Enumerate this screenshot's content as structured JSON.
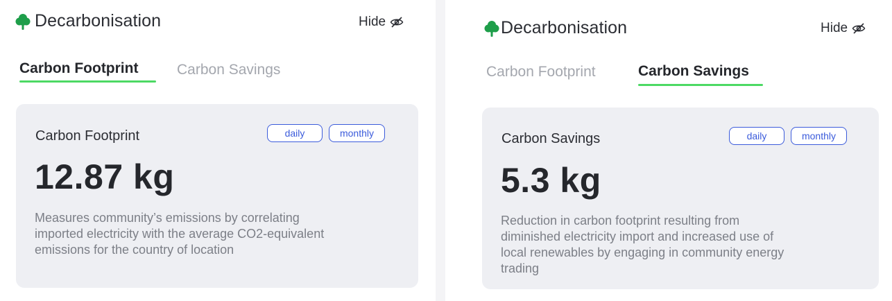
{
  "colors": {
    "accent_underline": "#4cd964",
    "pill_blue": "#3b5bdb",
    "card_bg": "#eeeff3",
    "tree_green": "#1e9e4a"
  },
  "icons": {
    "header": "tree-icon",
    "hide": "eye-slash-icon"
  },
  "left_panel": {
    "title": "Decarbonisation",
    "hide_label": "Hide",
    "tabs": [
      {
        "label": "Carbon Footprint",
        "active": true
      },
      {
        "label": "Carbon Savings",
        "active": false
      }
    ],
    "card": {
      "title": "Carbon Footprint",
      "toggles": [
        "daily",
        "monthly"
      ],
      "value": "12.87 kg",
      "description_lines": [
        "Measures community’s emissions by correlating",
        "imported electricity with the average CO2-equivalent",
        "emissions for the country of location"
      ]
    }
  },
  "right_panel": {
    "title": "Decarbonisation",
    "hide_label": "Hide",
    "tabs": [
      {
        "label": "Carbon Footprint",
        "active": false
      },
      {
        "label": "Carbon Savings",
        "active": true
      }
    ],
    "card": {
      "title": "Carbon Savings",
      "toggles": [
        "daily",
        "monthly"
      ],
      "value": "5.3 kg",
      "description_lines": [
        "Reduction in carbon footprint resulting from",
        "diminished electricity import and increased use of",
        "local renewables by engaging in community energy",
        "trading"
      ]
    }
  }
}
